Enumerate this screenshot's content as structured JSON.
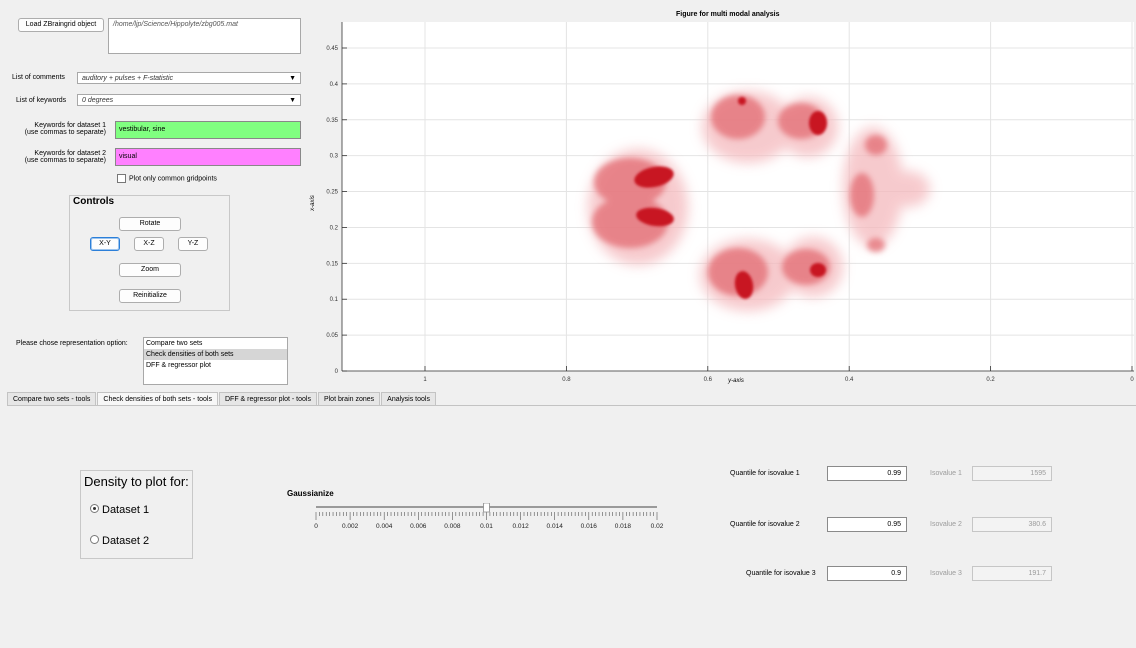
{
  "load": {
    "button_label": "Load ZBraingrid object",
    "path": "/home/ljp/Science/Hippolyte/zbg005.mat"
  },
  "comments": {
    "label": "List of comments",
    "value": "auditory + pulses + F-statistic"
  },
  "keywords": {
    "label": "List of keywords",
    "value": "0 degrees"
  },
  "dataset1": {
    "label_line1": "Keywords for dataset 1",
    "label_line2": "(use commas to separate)",
    "value": "vestibular, sine",
    "color": "#80ff80"
  },
  "dataset2": {
    "label_line1": "Keywords for dataset 2",
    "label_line2": "(use commas to separate)",
    "value": "visual",
    "color": "#ff80ff"
  },
  "common": {
    "label": "Plot only common gridpoints"
  },
  "controls": {
    "title": "Controls",
    "rotate": "Rotate",
    "xy": "X-Y",
    "xz": "X-Z",
    "yz": "Y-Z",
    "zoom": "Zoom",
    "reinit": "Reinitialize"
  },
  "representation": {
    "label": "Please chose representation option:",
    "options": [
      "Compare two sets",
      "Check densities of both sets",
      "DFF & regressor plot"
    ],
    "selected_index": 1
  },
  "figure": {
    "title": "Figure for multi modal analysis",
    "y_axis_label": "x-axis",
    "x_axis_label": "y-axis",
    "y_ticks": [
      "0.45",
      "0.4",
      "0.35",
      "0.3",
      "0.25",
      "0.2",
      "0.15",
      "0.1",
      "0.05",
      "0"
    ],
    "x_ticks": [
      "1",
      "0.8",
      "0.6",
      "0.4",
      "0.2",
      "0"
    ]
  },
  "tabs": [
    "Compare two sets - tools",
    "Check densities of both sets - tools",
    "DFF & regressor plot - tools",
    "Plot brain zones",
    "Analysis tools"
  ],
  "active_tab": 1,
  "density": {
    "title": "Density to plot for:",
    "option1": "Dataset 1",
    "option2": "Dataset 2"
  },
  "gauss": {
    "title": "Gaussianize",
    "ticks": [
      "0",
      "0.002",
      "0.004",
      "0.006",
      "0.008",
      "0.01",
      "0.012",
      "0.014",
      "0.016",
      "0.018",
      "0.02"
    ],
    "value": 0.01,
    "min": 0,
    "max": 0.02
  },
  "quantiles": [
    {
      "label": "Quantile for isovalue 1",
      "value": "0.99",
      "iso_label": "Isovalue 1",
      "iso_value": "1595"
    },
    {
      "label": "Quantile for isovalue 2",
      "value": "0.95",
      "iso_label": "Isovalue 2",
      "iso_value": "380.6"
    },
    {
      "label": "Quantile for isovalue 3",
      "value": "0.9",
      "iso_label": "Isovalue 3",
      "iso_value": "191.7"
    }
  ]
}
